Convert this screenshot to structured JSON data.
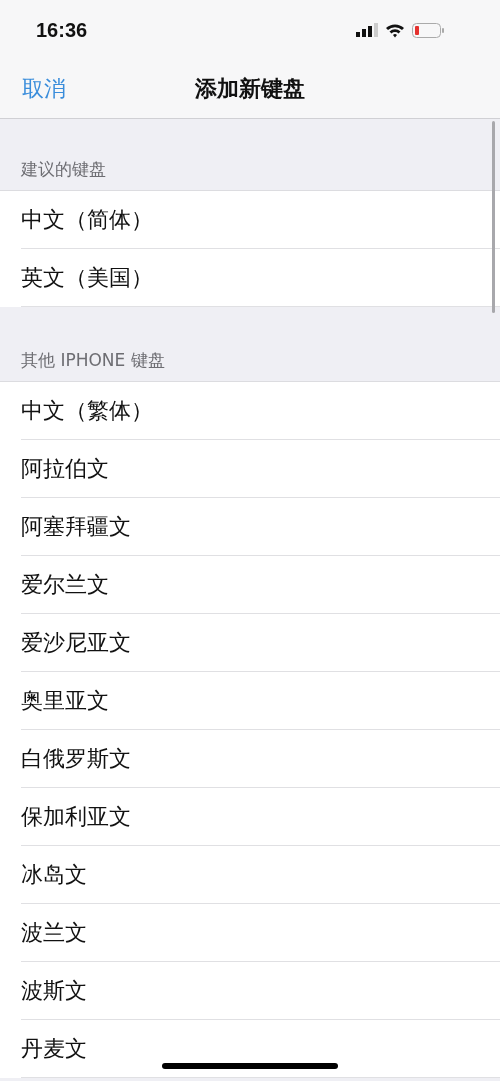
{
  "status_bar": {
    "time": "16:36"
  },
  "nav": {
    "cancel": "取消",
    "title": "添加新键盘"
  },
  "sections": [
    {
      "header": "建议的键盘",
      "items": [
        "中文（简体）",
        "英文（美国）"
      ]
    },
    {
      "header": "其他 IPHONE 键盘",
      "items": [
        "中文（繁体）",
        "阿拉伯文",
        "阿塞拜疆文",
        "爱尔兰文",
        "爱沙尼亚文",
        "奥里亚文",
        "白俄罗斯文",
        "保加利亚文",
        "冰岛文",
        "波兰文",
        "波斯文",
        "丹麦文"
      ]
    }
  ]
}
